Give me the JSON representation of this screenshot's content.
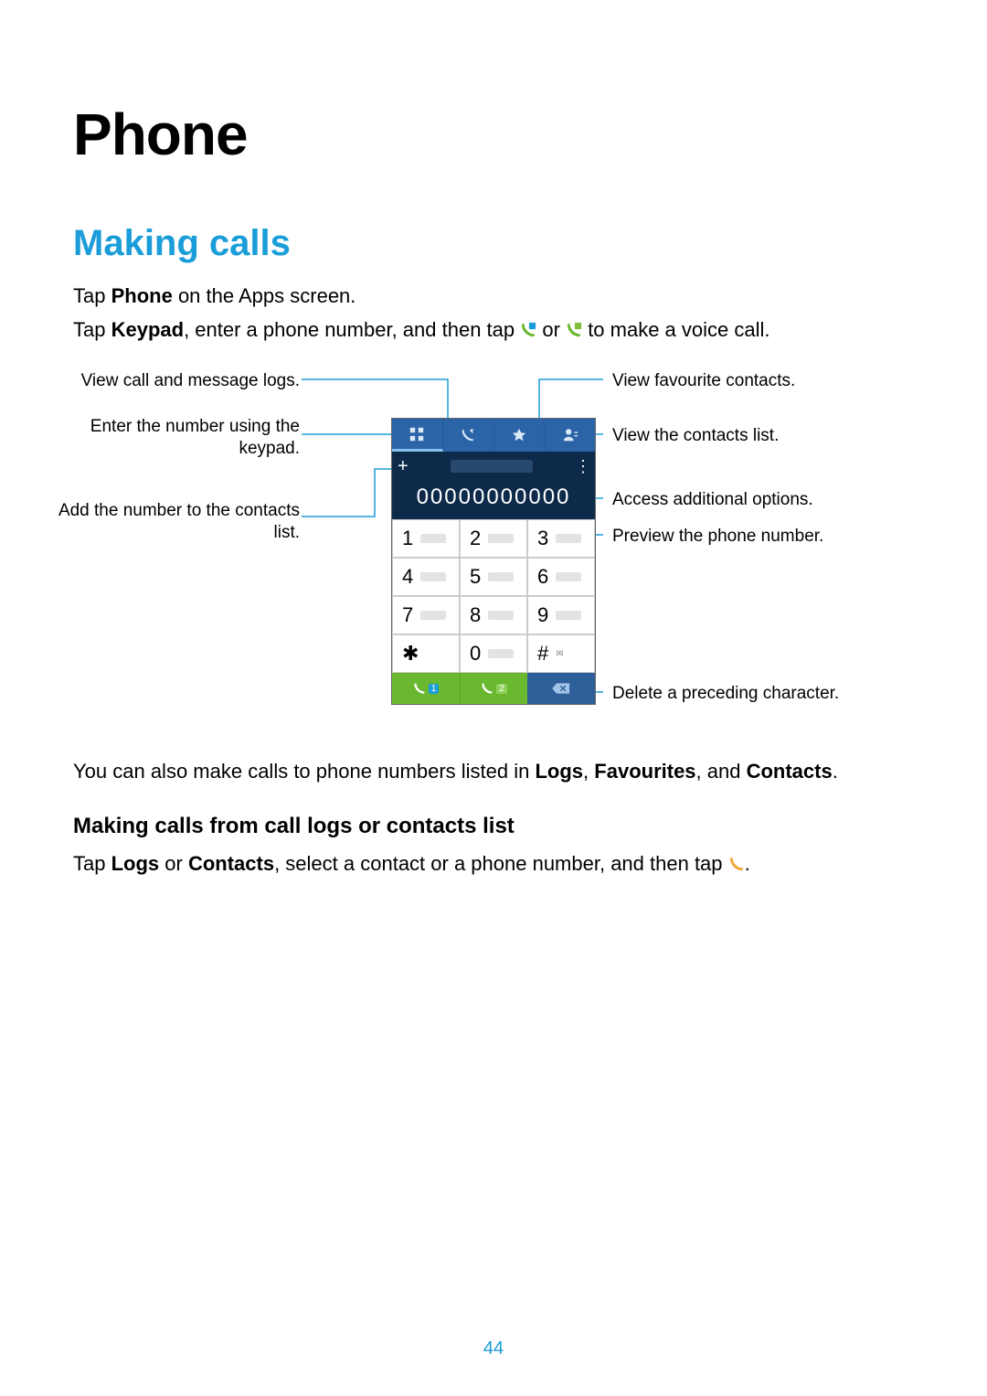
{
  "page": {
    "title": "Phone",
    "number": "44"
  },
  "section": {
    "heading": "Making calls",
    "p1a": "Tap ",
    "p1b": "Phone",
    "p1c": " on the Apps screen.",
    "p2a": "Tap ",
    "p2b": "Keypad",
    "p2c": ", enter a phone number, and then tap ",
    "p2d": " or ",
    "p2e": " to make a voice call.",
    "p3a": "You can also make calls to phone numbers listed in ",
    "p3b": "Logs",
    "p3c": ", ",
    "p3d": "Favourites",
    "p3e": ", and ",
    "p3f": "Contacts",
    "p3g": "."
  },
  "subsection": {
    "heading": "Making calls from call logs or contacts list",
    "p1a": "Tap ",
    "p1b": "Logs",
    "p1c": " or ",
    "p1d": "Contacts",
    "p1e": ", select a contact or a phone number, and then tap ",
    "p1f": "."
  },
  "figure": {
    "callouts": {
      "logs": "View call and message logs.",
      "keypad": "Enter the number using the keypad.",
      "add": "Add the number to the contacts list.",
      "fav": "View favourite contacts.",
      "contacts": "View the contacts list.",
      "options": "Access additional options.",
      "preview": "Preview the phone number.",
      "delete": "Delete a preceding character."
    },
    "phone": {
      "number_display": "00000000000",
      "keys": [
        "1",
        "2",
        "3",
        "4",
        "5",
        "6",
        "7",
        "8",
        "9",
        "✱",
        "0",
        "#"
      ],
      "call_badge1": "1",
      "call_badge2": "2"
    }
  }
}
